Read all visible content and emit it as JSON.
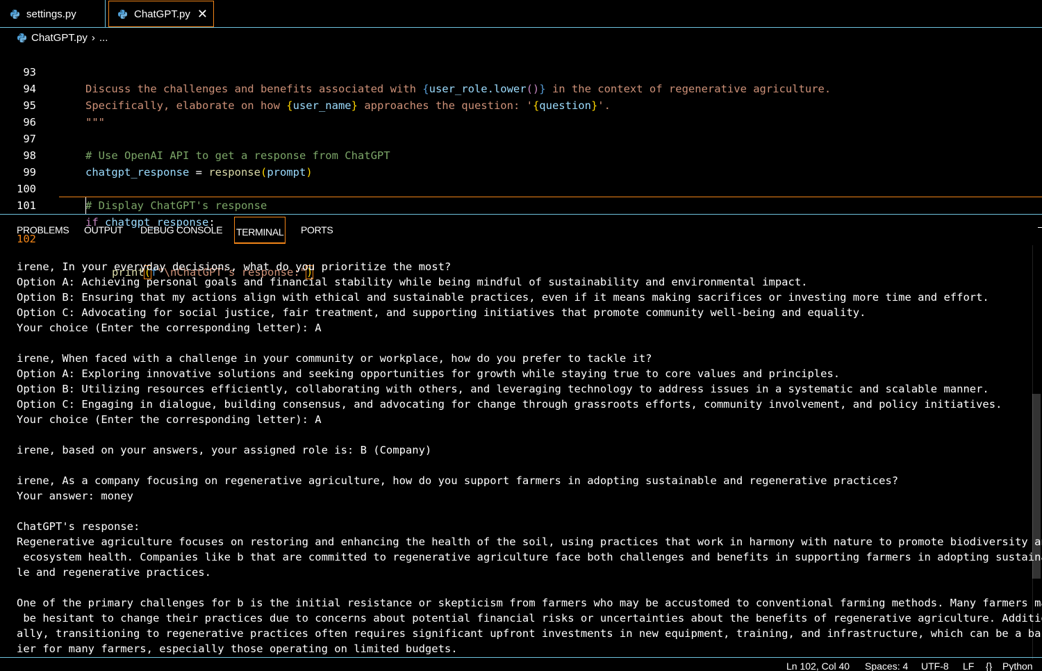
{
  "tabs": [
    {
      "label": "settings.py",
      "active": false
    },
    {
      "label": "ChatGPT.py",
      "active": true,
      "close": "✕"
    }
  ],
  "breadcrumb": {
    "file": "ChatGPT.py",
    "sep": "›",
    "more": "..."
  },
  "editor": {
    "line_numbers": [
      "93",
      "94",
      "95",
      "96",
      "97",
      "98",
      "99",
      "100",
      "101",
      "102"
    ],
    "line93": {
      "a": "Discuss the challenges and benefits associated with ",
      "b": "{",
      "c": "user_role.lower",
      "d": "()",
      "e": "}",
      "f": " in the context of regenerative agriculture."
    },
    "line94": {
      "a": "Specifically, elaborate on how ",
      "b": "{",
      "c": "user_name",
      "d": "}",
      "e": " approaches the question: '",
      "f": "{",
      "g": "question",
      "h": "}",
      "i": "'."
    },
    "line95": "\"\"\"",
    "line97": "# Use OpenAI API to get a response from ChatGPT",
    "line98": {
      "a": "chatgpt_response",
      "b": " = ",
      "c": "response",
      "d": "(",
      "e": "prompt",
      "f": ")"
    },
    "line100": "# Display ChatGPT's response",
    "line101": {
      "a": "if",
      "b": " chatgpt_response",
      "c": ":"
    },
    "line102": {
      "a": "print",
      "b": "(",
      "c": "f",
      "d": "\"\\nChatGPT's response:\"",
      "e": ")"
    }
  },
  "panel_tabs": [
    "PROBLEMS",
    "OUTPUT",
    "DEBUG CONSOLE",
    "TERMINAL",
    "PORTS"
  ],
  "terminal_lines": [
    "irene, In your everyday decisions, what do you prioritize the most?",
    "Option A: Achieving personal goals and financial stability while being mindful of sustainability and environmental impact.",
    "Option B: Ensuring that my actions align with ethical and sustainable practices, even if it means making sacrifices or investing more time and effort.",
    "Option C: Advocating for social justice, fair treatment, and supporting initiatives that promote community well-being and equality.",
    "Your choice (Enter the corresponding letter): A",
    "",
    "irene, When faced with a challenge in your community or workplace, how do you prefer to tackle it?",
    "Option A: Exploring innovative solutions and seeking opportunities for growth while staying true to core values and principles.",
    "Option B: Utilizing resources efficiently, collaborating with others, and leveraging technology to address issues in a systematic and scalable manner.",
    "Option C: Engaging in dialogue, building consensus, and advocating for change through grassroots efforts, community involvement, and policy initiatives.",
    "Your choice (Enter the corresponding letter): A",
    "",
    "irene, based on your answers, your assigned role is: B (Company)",
    "",
    "irene, As a company focusing on regenerative agriculture, how do you support farmers in adopting sustainable and regenerative practices?",
    "Your answer: money",
    "",
    "ChatGPT's response:",
    "Regenerative agriculture focuses on restoring and enhancing the health of the soil, using practices that work in harmony with nature to promote biodiversity and",
    " ecosystem health. Companies like b that are committed to regenerative agriculture face both challenges and benefits in supporting farmers in adopting sustainab",
    "le and regenerative practices.",
    "",
    "One of the primary challenges for b is the initial resistance or skepticism from farmers who may be accustomed to conventional farming methods. Many farmers may",
    " be hesitant to change their practices due to concerns about potential financial risks or uncertainties about the benefits of regenerative agriculture. Addition",
    "ally, transitioning to regenerative practices often requires significant upfront investments in new equipment, training, and infrastructure, which can be a barr",
    "ier for many farmers, especially those operating on limited budgets."
  ],
  "statusbar": {
    "position": "Ln 102, Col 40",
    "spaces": "Spaces: 4",
    "encoding": "UTF-8",
    "eol": "LF",
    "language_icon": "{}",
    "language": "Python"
  },
  "colors": {
    "accent_orange": "#f38518",
    "border_cyan": "#6fc3df",
    "string": "#ce9178",
    "comment": "#7ca668",
    "variable": "#9cdcfe",
    "bracket": "#ffd700",
    "keyword": "#c586c0"
  }
}
